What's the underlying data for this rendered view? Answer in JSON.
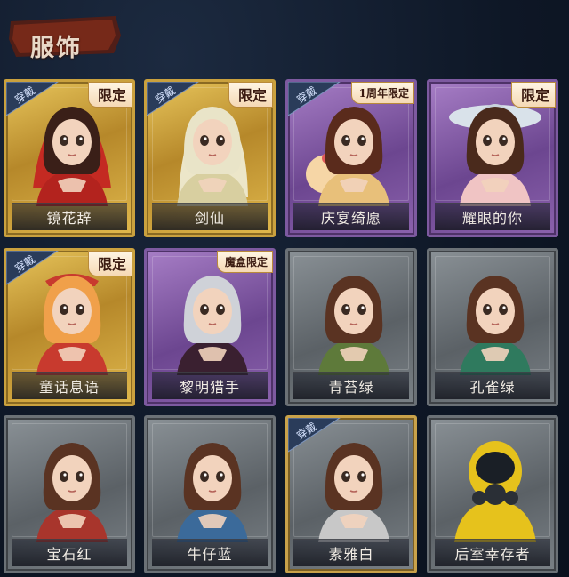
{
  "title": "服饰",
  "worn_label": "穿戴",
  "cards": [
    {
      "name": "镜花辞",
      "style": "gold",
      "badge": "限定",
      "worn": true,
      "portrait": "red-hood-girl"
    },
    {
      "name": "剑仙",
      "style": "gold",
      "badge": "限定",
      "worn": true,
      "portrait": "white-hair-swordsman"
    },
    {
      "name": "庆宴绮愿",
      "style": "purple",
      "badge": "1周年限定",
      "worn": true,
      "portrait": "cake-girl"
    },
    {
      "name": "耀眼的你",
      "style": "purple",
      "badge": "限定",
      "worn": false,
      "portrait": "cowboy-hat-girl"
    },
    {
      "name": "童话息语",
      "style": "gold",
      "badge": "限定",
      "worn": true,
      "portrait": "fairy-tale-girl"
    },
    {
      "name": "黎明猎手",
      "style": "purple",
      "badge": "魔盒限定",
      "worn": false,
      "portrait": "hunter-man"
    },
    {
      "name": "青苔绿",
      "style": "grey",
      "badge": "",
      "worn": false,
      "portrait": "girl-green"
    },
    {
      "name": "孔雀绿",
      "style": "grey",
      "badge": "",
      "worn": false,
      "portrait": "girl-teal"
    },
    {
      "name": "宝石红",
      "style": "grey",
      "badge": "",
      "worn": false,
      "portrait": "girl-red"
    },
    {
      "name": "牛仔蓝",
      "style": "grey",
      "badge": "",
      "worn": false,
      "portrait": "girl-blue"
    },
    {
      "name": "素雅白",
      "style": "equipped-grey",
      "badge": "",
      "worn": true,
      "portrait": "girl-white"
    },
    {
      "name": "后室幸存者",
      "style": "grey",
      "badge": "",
      "worn": false,
      "portrait": "hazmat-suit"
    }
  ],
  "colors": {
    "gold": "#caa13e",
    "purple": "#7d5aa0",
    "grey": "#6b7176",
    "background": "#0e1726"
  }
}
